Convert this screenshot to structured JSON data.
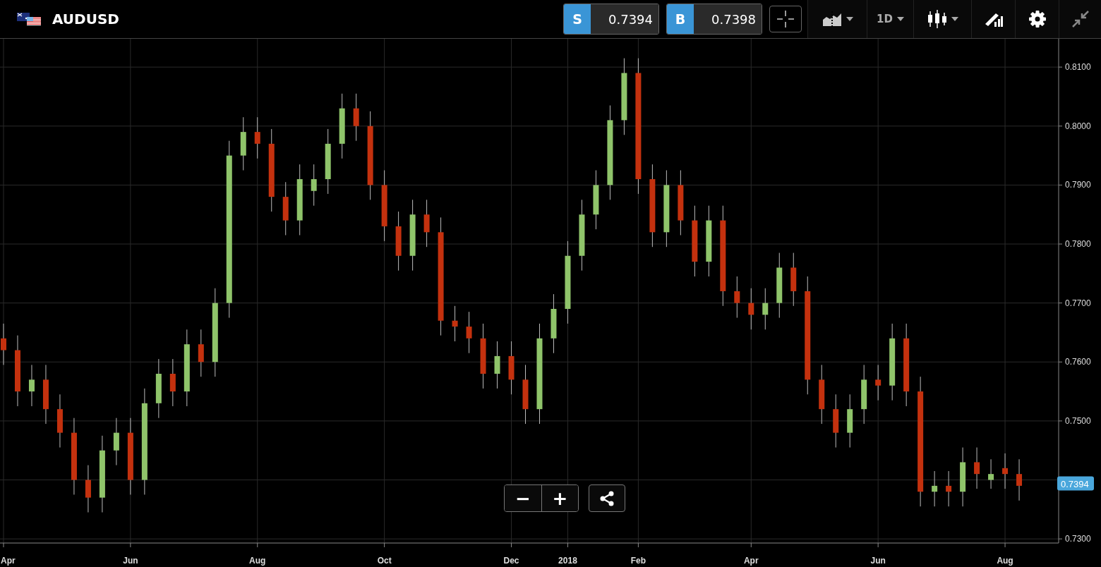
{
  "header": {
    "symbol": "AUDUSD",
    "sell": {
      "label": "S",
      "price": "0.7394"
    },
    "buy": {
      "label": "B",
      "price": "0.7398"
    },
    "timeframe": "1D"
  },
  "chart": {
    "current_price": "0.7394",
    "chart_data": {
      "type": "candlestick",
      "categories": [
        "Apr",
        null,
        null,
        null,
        null,
        null,
        null,
        null,
        null,
        "Jun",
        null,
        null,
        null,
        null,
        null,
        null,
        null,
        null,
        "Aug",
        null,
        null,
        null,
        null,
        null,
        null,
        null,
        null,
        "Oct",
        null,
        null,
        null,
        null,
        null,
        null,
        null,
        null,
        "Dec",
        null,
        null,
        null,
        "2018",
        null,
        null,
        null,
        null,
        "Feb",
        null,
        null,
        null,
        null,
        null,
        null,
        null,
        "Apr",
        null,
        null,
        null,
        null,
        null,
        null,
        null,
        null,
        "Jun",
        null,
        null,
        null,
        null,
        null,
        null,
        null,
        null,
        "Aug",
        null
      ],
      "ohlc": [
        [
          0.764,
          0.7665,
          0.7595,
          0.762
        ],
        [
          0.762,
          0.7645,
          0.7525,
          0.755
        ],
        [
          0.755,
          0.7595,
          0.7525,
          0.757
        ],
        [
          0.757,
          0.7595,
          0.7495,
          0.752
        ],
        [
          0.752,
          0.7545,
          0.7455,
          0.748
        ],
        [
          0.748,
          0.7505,
          0.7375,
          0.74
        ],
        [
          0.74,
          0.7425,
          0.7345,
          0.737
        ],
        [
          0.737,
          0.7475,
          0.7345,
          0.745
        ],
        [
          0.745,
          0.7505,
          0.7425,
          0.748
        ],
        [
          0.748,
          0.7505,
          0.7375,
          0.74
        ],
        [
          0.74,
          0.7555,
          0.7375,
          0.753
        ],
        [
          0.753,
          0.7605,
          0.7505,
          0.758
        ],
        [
          0.758,
          0.7605,
          0.7525,
          0.755
        ],
        [
          0.755,
          0.7655,
          0.7525,
          0.763
        ],
        [
          0.763,
          0.7655,
          0.7575,
          0.76
        ],
        [
          0.76,
          0.7725,
          0.7575,
          0.77
        ],
        [
          0.77,
          0.7975,
          0.7675,
          0.795
        ],
        [
          0.795,
          0.8015,
          0.7925,
          0.799
        ],
        [
          0.799,
          0.8015,
          0.7945,
          0.797
        ],
        [
          0.797,
          0.7995,
          0.7855,
          0.788
        ],
        [
          0.788,
          0.7905,
          0.7815,
          0.784
        ],
        [
          0.784,
          0.7935,
          0.7815,
          0.791
        ],
        [
          0.789,
          0.7935,
          0.7865,
          0.791
        ],
        [
          0.791,
          0.7995,
          0.7885,
          0.797
        ],
        [
          0.797,
          0.8055,
          0.7945,
          0.803
        ],
        [
          0.803,
          0.8055,
          0.7975,
          0.8
        ],
        [
          0.8,
          0.8025,
          0.7875,
          0.79
        ],
        [
          0.79,
          0.7925,
          0.7805,
          0.783
        ],
        [
          0.783,
          0.7855,
          0.7755,
          0.778
        ],
        [
          0.778,
          0.7875,
          0.7755,
          0.785
        ],
        [
          0.785,
          0.7875,
          0.7795,
          0.782
        ],
        [
          0.782,
          0.7845,
          0.7645,
          0.767
        ],
        [
          0.767,
          0.7695,
          0.7635,
          0.766
        ],
        [
          0.766,
          0.7685,
          0.7615,
          0.764
        ],
        [
          0.764,
          0.7665,
          0.7555,
          0.758
        ],
        [
          0.758,
          0.7635,
          0.7555,
          0.761
        ],
        [
          0.761,
          0.7635,
          0.7545,
          0.757
        ],
        [
          0.757,
          0.7595,
          0.7495,
          0.752
        ],
        [
          0.752,
          0.7665,
          0.7495,
          0.764
        ],
        [
          0.764,
          0.7715,
          0.7615,
          0.769
        ],
        [
          0.769,
          0.7805,
          0.7665,
          0.778
        ],
        [
          0.778,
          0.7875,
          0.7755,
          0.785
        ],
        [
          0.785,
          0.7925,
          0.7825,
          0.79
        ],
        [
          0.79,
          0.8035,
          0.7875,
          0.801
        ],
        [
          0.801,
          0.8115,
          0.7985,
          0.809
        ],
        [
          0.809,
          0.8115,
          0.7885,
          0.791
        ],
        [
          0.791,
          0.7935,
          0.7795,
          0.782
        ],
        [
          0.782,
          0.7925,
          0.7795,
          0.79
        ],
        [
          0.79,
          0.7925,
          0.7815,
          0.784
        ],
        [
          0.784,
          0.7865,
          0.7745,
          0.777
        ],
        [
          0.777,
          0.7865,
          0.7745,
          0.784
        ],
        [
          0.784,
          0.7865,
          0.7695,
          0.772
        ],
        [
          0.772,
          0.7745,
          0.7675,
          0.77
        ],
        [
          0.77,
          0.7725,
          0.7655,
          0.768
        ],
        [
          0.768,
          0.7725,
          0.7655,
          0.77
        ],
        [
          0.77,
          0.7785,
          0.7675,
          0.776
        ],
        [
          0.776,
          0.7785,
          0.7695,
          0.772
        ],
        [
          0.772,
          0.7745,
          0.7545,
          0.757
        ],
        [
          0.757,
          0.7595,
          0.7495,
          0.752
        ],
        [
          0.752,
          0.7545,
          0.7455,
          0.748
        ],
        [
          0.748,
          0.7545,
          0.7455,
          0.752
        ],
        [
          0.752,
          0.7595,
          0.7495,
          0.757
        ],
        [
          0.757,
          0.7595,
          0.7535,
          0.756
        ],
        [
          0.756,
          0.7665,
          0.7535,
          0.764
        ],
        [
          0.764,
          0.7665,
          0.7525,
          0.755
        ],
        [
          0.755,
          0.7575,
          0.7355,
          0.738
        ],
        [
          0.738,
          0.7415,
          0.7355,
          0.739
        ],
        [
          0.739,
          0.7415,
          0.7355,
          0.738
        ],
        [
          0.738,
          0.7455,
          0.7355,
          0.743
        ],
        [
          0.743,
          0.7455,
          0.7385,
          0.741
        ],
        [
          0.74,
          0.7435,
          0.7385,
          0.741
        ],
        [
          0.742,
          0.7445,
          0.7385,
          0.741
        ],
        [
          0.741,
          0.7435,
          0.7365,
          0.739
        ]
      ],
      "grid": true,
      "ylim": [
        0.7293,
        0.8148
      ],
      "yticks": [
        {
          "value": 0.73,
          "label": "0.7300"
        },
        {
          "value": 0.75,
          "label": "0.7500"
        },
        {
          "value": 0.76,
          "label": "0.7600"
        },
        {
          "value": 0.77,
          "label": "0.7700"
        },
        {
          "value": 0.78,
          "label": "0.7800"
        },
        {
          "value": 0.79,
          "label": "0.7900"
        },
        {
          "value": 0.8,
          "label": "0.8000"
        },
        {
          "value": 0.81,
          "label": "0.8100"
        }
      ]
    }
  },
  "zoom_controls": {
    "minus": "−",
    "plus": "+"
  }
}
